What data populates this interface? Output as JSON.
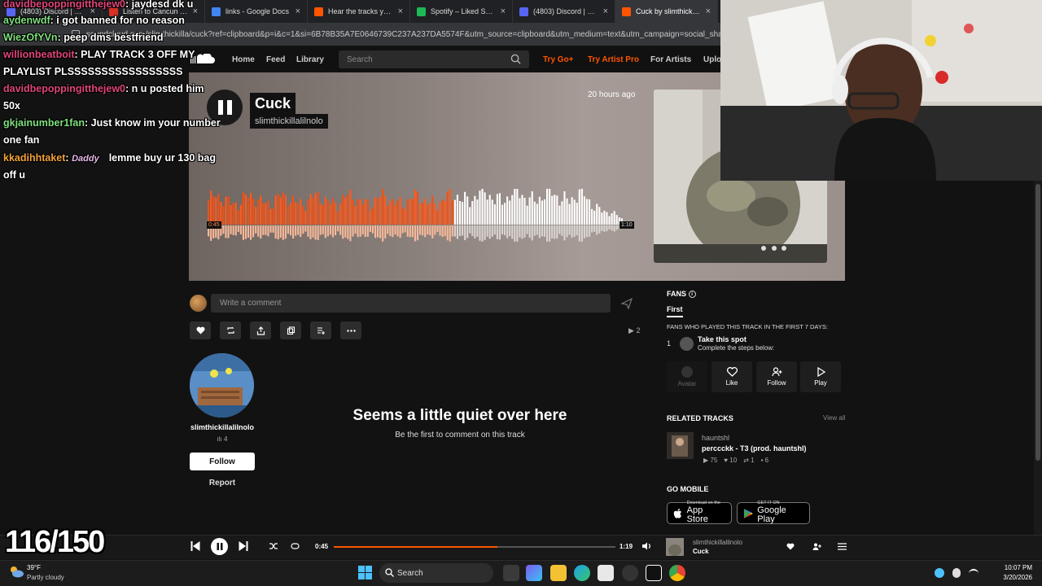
{
  "browser": {
    "tabs": [
      {
        "title": "(4803) Discord | @422...",
        "color": "#5865f2"
      },
      {
        "title": "Listen to Cancun by Li...",
        "color": "#d93025"
      },
      {
        "title": "links - Google Docs",
        "color": "#4285f4"
      },
      {
        "title": "Hear the tracks you've...",
        "color": "#ff5500"
      },
      {
        "title": "Spotify – Liked Songs",
        "color": "#1db954"
      },
      {
        "title": "(4803) Discord | @422...",
        "color": "#5865f2"
      },
      {
        "title": "Cuck by slimthickill...",
        "color": "#ff5500"
      }
    ],
    "url": "soundcloud.com/slimthickilla/cuck?ref=clipboard&p=i&c=1&si=6B78B35A7E0646739C237A237DA5574F&utm_source=clipboard&utm_medium=text&utm_campaign=social_sharing"
  },
  "header": {
    "nav": [
      "Home",
      "Feed",
      "Library"
    ],
    "search_placeholder": "Search",
    "try_go": "Try Go+",
    "try_artist_pro": "Try Artist Pro",
    "for_artists": "For Artists",
    "upload": "Uplo"
  },
  "track": {
    "title": "Cuck",
    "artist": "slimthickillalilnolo",
    "posted_ago": "20 hours ago",
    "elapsed": "0:45",
    "duration": "1:10",
    "progress": 0.58,
    "plays": "2"
  },
  "comment": {
    "placeholder": "Write a comment"
  },
  "uploader": {
    "name": "slimthickillalilnolo",
    "followers": "4",
    "follow_label": "Follow",
    "report_label": "Report"
  },
  "empty_comments": {
    "title": "Seems a little quiet over here",
    "subtitle": "Be the first to comment on this track"
  },
  "fans": {
    "heading": "FANS",
    "tab": "First",
    "subheading": "FANS WHO PLAYED THIS TRACK IN THE FIRST 7 DAYS:",
    "rank": "1",
    "spot_title": "Take this spot",
    "spot_sub": "Complete the steps below:",
    "buttons": [
      "Avatar",
      "Like",
      "Follow",
      "Play"
    ]
  },
  "related": {
    "heading": "RELATED TRACKS",
    "view_all": "View all",
    "item": {
      "artist": "hauntshl",
      "title": "perccckk - T3 (prod. hauntshl)",
      "plays": "75",
      "likes": "10",
      "reposts": "1",
      "comments": "6"
    }
  },
  "mobile": {
    "heading": "GO MOBILE",
    "app_store_small": "Download on the",
    "app_store_big": "App Store",
    "google_small": "GET IT ON",
    "google_big": "Google Play"
  },
  "player": {
    "elapsed": "0:45",
    "duration": "1:19",
    "progress": 0.58,
    "artist": "slimthickillalilnolo",
    "title": "Cuck"
  },
  "taskbar": {
    "temp": "39°F",
    "weather": "Partly cloudy",
    "search": "Search",
    "time": "10:07 PM",
    "date": "3/20/2026"
  },
  "overlay": {
    "chat": [
      {
        "user": "davidbepoppingitthejew0",
        "msg": "jaydesd dk u",
        "color": "#e0457b"
      },
      {
        "user": "aydenwdf",
        "msg": "i got banned for no reason",
        "color": "#7fe07f"
      },
      {
        "user": "WiezOfYVn",
        "msg": "peep dms bestfriend",
        "color": "#7fe07f"
      },
      {
        "user": "willionbeatboit",
        "msg": "PLAY TRACK 3 OFF MY",
        "color": "#e0457b"
      },
      {
        "user": "",
        "msg": "PLAYLIST PLSSSSSSSSSSSSSSSSS",
        "color": "#ffffff"
      },
      {
        "user": "davidbepoppingitthejew0",
        "msg": "n u posted him",
        "color": "#e0457b"
      },
      {
        "user": "",
        "msg": "50x",
        "color": "#ffffff"
      },
      {
        "user": "gkjainumber1fan",
        "msg": "Just know im your number",
        "color": "#7fe07f"
      },
      {
        "user": "",
        "msg": "one fan",
        "color": "#ffffff"
      },
      {
        "user": "kkadihhtaket",
        "msg": "lemme buy ur 130 bag",
        "color": "#f2a33a",
        "badge": "Daddy"
      },
      {
        "user": "",
        "msg": "off u",
        "color": "#ffffff"
      }
    ],
    "counter": "116/150"
  },
  "colors": {
    "accent": "#ff5500",
    "background": "#121212"
  }
}
